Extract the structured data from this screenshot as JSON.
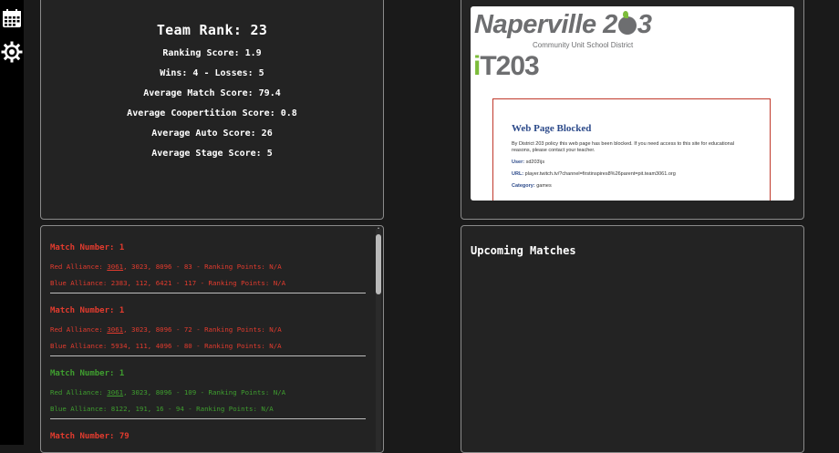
{
  "sidebar": {
    "items": [
      {
        "icon": "calendar-icon"
      },
      {
        "icon": "gear-icon"
      }
    ]
  },
  "team": {
    "title": "Team Rank: 23",
    "stats": [
      "Ranking Score: 1.9",
      "Wins: 4 - Losses: 5",
      "Average Match Score: 79.4",
      "Average Coopertition Score: 0.8",
      "Average Auto Score: 26",
      "Average Stage Score: 5"
    ]
  },
  "matches": [
    {
      "title": "Match Number: 1",
      "winner": "red",
      "red": {
        "prefix": "Red Alliance: ",
        "team": "3061",
        "rest": ", 3023, 8096 - 83 - Ranking Points: N/A"
      },
      "blue": "Blue Alliance: 2383, 112, 6421 - 117 - Ranking Points: N/A"
    },
    {
      "title": "Match Number: 1",
      "winner": "red",
      "red": {
        "prefix": "Red Alliance: ",
        "team": "3061",
        "rest": ", 3023, 8096 - 72 - Ranking Points: N/A"
      },
      "blue": "Blue Alliance: 5934, 111, 4096 - 80 - Ranking Points: N/A"
    },
    {
      "title": "Match Number: 1",
      "winner": "green",
      "red": {
        "prefix": "Red Alliance: ",
        "team": "3061",
        "rest": ", 3023, 8096 - 109 - Ranking Points: N/A"
      },
      "blue": "Blue Alliance: 8122, 191, 16 - 94 - Ranking Points: N/A"
    },
    {
      "title": "Match Number: 79",
      "winner": "red",
      "red": {
        "prefix": "",
        "team": "",
        "rest": ""
      },
      "blue": ""
    }
  ],
  "stream": {
    "logo_text_a": "Naperville 2",
    "logo_text_b": "3",
    "logo_sub": "Community Unit School District",
    "logo_it_i": "i",
    "logo_it_rest": "T203",
    "blocked_title": "Web Page Blocked",
    "blocked_msg": "By District 203 policy this web page has been blocked. If you need access to this site for educational reasons, please contact your teacher.",
    "user_label": "User:",
    "user_value": "sd203\\js",
    "url_label": "URL:",
    "url_value": "player.twitch.tv/?channel=firstinspires8%26parent=pit.team3061.org",
    "category_label": "Category:",
    "category_value": "games"
  },
  "upcoming": {
    "heading": "Upcoming Matches"
  },
  "colors": {
    "red": "#e33b2e",
    "green": "#3f9e2f",
    "panel": "#232323",
    "background": "#1a1a1a"
  }
}
